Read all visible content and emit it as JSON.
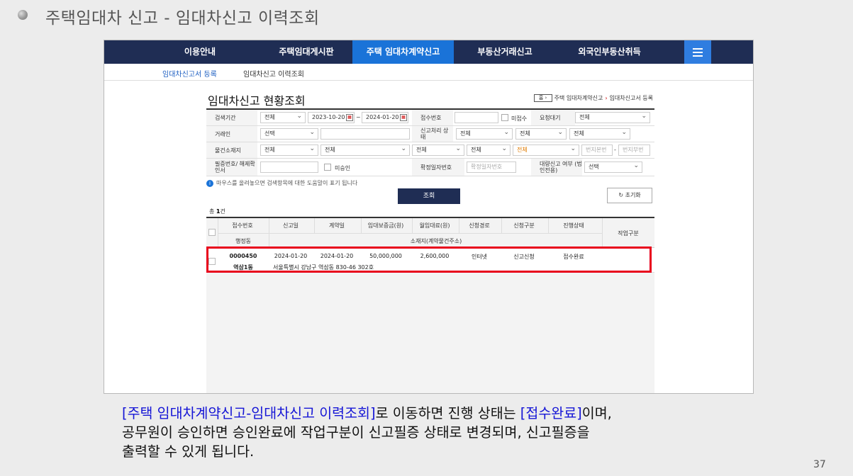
{
  "slide": {
    "title": "주택임대차 신고 - 임대차신고 이력조회",
    "page_number": "37",
    "caption": {
      "line1_link": "[주택 임대차계약신고-임대차신고 이력조회]",
      "line1_mid": "로 이동하면 진행 상태는 ",
      "line1_status": "[접수완료]",
      "line1_end": "이며,",
      "line2": "공무원이 승인하면 승인완료에 작업구분이 신고필증 상태로 변경되며, 신고필증을",
      "line3": "출력할 수 있게 됩니다."
    }
  },
  "topnav": {
    "items": [
      "이용안내",
      "주택임대게시판",
      "주택 임대차계약신고",
      "부동산거래신고",
      "외국인부동산취득"
    ],
    "active_index": 2
  },
  "subnav": {
    "items": [
      "임대차신고서 등록",
      "임대차신고 이력조회"
    ]
  },
  "page": {
    "heading": "임대차신고 현황조회",
    "breadcrumb": {
      "home": "홈",
      "items": [
        "주택 임대차계약신고",
        "임대차신고서 등록"
      ]
    }
  },
  "search": {
    "period_label": "검색기간",
    "period_type": "전체",
    "date_from": "2023-10-20",
    "date_sep": "~",
    "date_to": "2024-01-20",
    "receipt_no_label": "접수번호",
    "receipt_no_value": "",
    "unreceived_label": "미접수",
    "request_label": "요청대기",
    "request_value": "전체",
    "party_label": "거래인",
    "party_select": "선택",
    "party_text": "",
    "process_label": "신고처리 상태",
    "process_1": "전체",
    "process_2": "전체",
    "process_3": "전체",
    "location_label": "물건소재지",
    "loc_1": "전체",
    "loc_2": "전체",
    "loc_3": "전체",
    "loc_4": "전체",
    "loc_5": "전체",
    "main_lot_ph": "번지본번",
    "lot_sep": "-",
    "sub_lot_ph": "번지부번",
    "cert_label": "필증번호/ 해제확인서",
    "cert_value": "",
    "unapproved_label": "미승인",
    "fixed_date_label": "확정일자번호",
    "fixed_date_ph": "확정일자번호",
    "agent_label": "대량신고 여부 (법인전용)",
    "agent_value": "선택"
  },
  "help_text": "마우스를 올려놓으면 검색항목에 대한 도움말이 표기 됩니다",
  "buttons": {
    "search": "조회",
    "reset": "초기화"
  },
  "total": {
    "prefix": "총 ",
    "count": "1",
    "suffix": "건"
  },
  "grid": {
    "headers": [
      "접수번호",
      "신고일",
      "계약일",
      "임대보증금(원)",
      "월임대료(원)",
      "신청경로",
      "신청구분",
      "진행상태",
      "작업구분"
    ],
    "sub_headers": [
      "행정동",
      "소재지(계약물건주소)"
    ],
    "rows": [
      {
        "receipt_no": "0000450",
        "report_date": "2024-01-20",
        "contract_date": "2024-01-20",
        "deposit": "50,000,000",
        "monthly_rent": "2,600,000",
        "channel": "인터넷",
        "type": "신고신청",
        "status": "접수완료",
        "work": "",
        "dong": "역삼1동",
        "address": "서울특별시 강남구 역삼동 830-46 302호"
      }
    ]
  },
  "colors": {
    "nav_bg": "#1f2d54",
    "nav_active": "#1a73d8",
    "highlight": "#e8001c",
    "caption_blue": "#1515d6"
  }
}
